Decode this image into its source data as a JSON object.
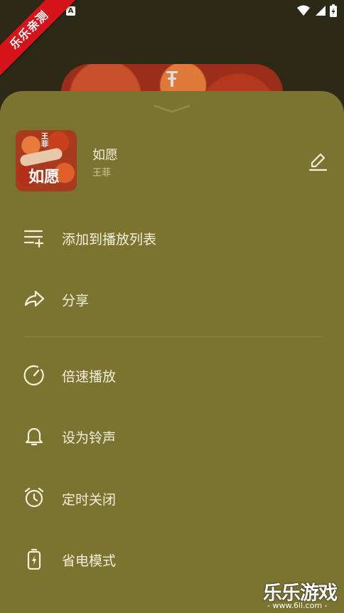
{
  "status_bar": {
    "notification_icon": "a-icon",
    "icons": [
      "wifi-icon",
      "signal-icon",
      "battery-charging-icon"
    ]
  },
  "watermark_ribbon": "乐乐亲测",
  "song": {
    "title": "如愿",
    "artist": "王菲",
    "cover_text": "如愿"
  },
  "menu": [
    {
      "icon": "add-to-playlist-icon",
      "label": "添加到播放列表"
    },
    {
      "icon": "share-icon",
      "label": "分享"
    },
    {
      "icon": "speed-icon",
      "label": "倍速播放"
    },
    {
      "icon": "bell-icon",
      "label": "设为铃声"
    },
    {
      "icon": "alarm-clock-icon",
      "label": "定时关闭"
    },
    {
      "icon": "battery-saver-icon",
      "label": "省电模式"
    }
  ],
  "watermark": {
    "title": "乐乐游戏",
    "url": "- www.6ll.com -"
  },
  "colors": {
    "background": "#2c2a16",
    "sheet": "#7b7430",
    "text": "#f4f0dc",
    "ribbon": "#d4141a"
  }
}
